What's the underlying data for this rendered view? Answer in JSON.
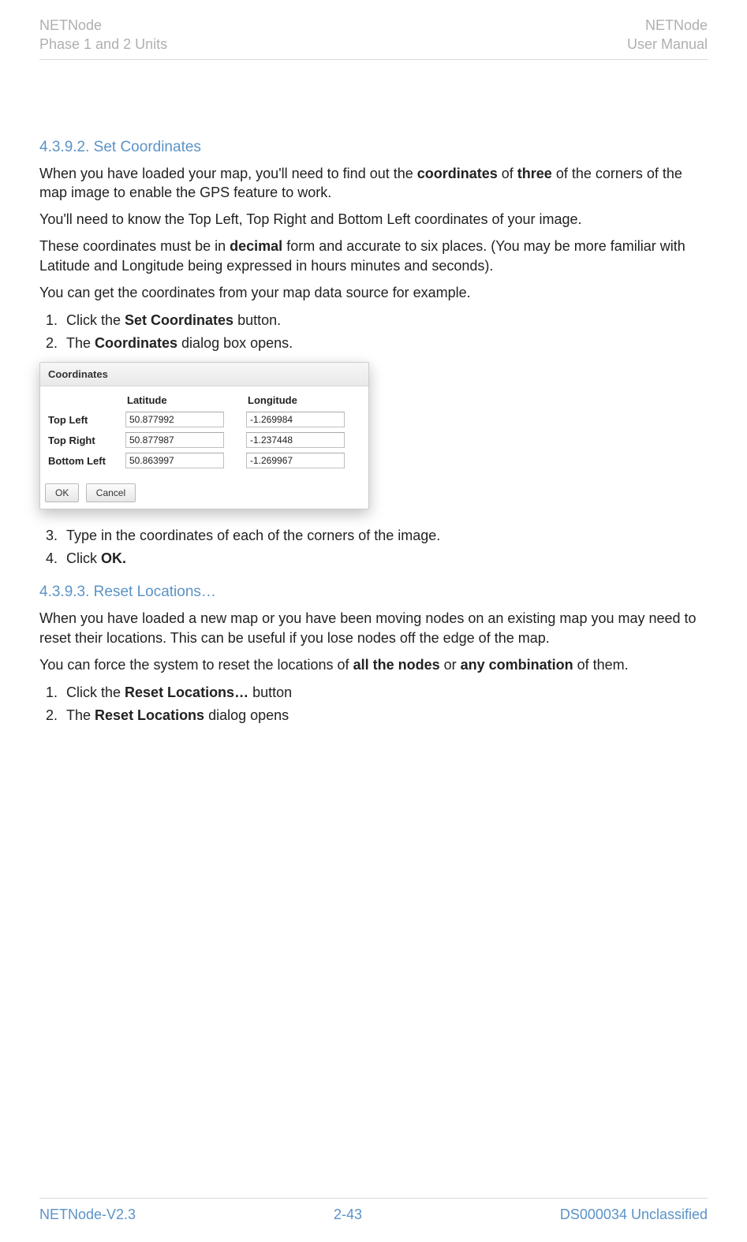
{
  "header": {
    "left_line1": "NETNode",
    "left_line2": "Phase 1 and 2 Units",
    "right_line1": "NETNode",
    "right_line2": "User Manual"
  },
  "section1": {
    "number_title": "4.3.9.2. Set Coordinates",
    "p1_pre": "When you have loaded your map, you'll need to find out the ",
    "p1_b1": "coordinates",
    "p1_mid": " of ",
    "p1_b2": "three",
    "p1_post": " of the corners of the map image to enable the GPS feature to work.",
    "p2": "You'll need to know the Top Left, Top Right and Bottom Left coordinates of your image.",
    "p3_pre": "These coordinates must be in ",
    "p3_b": "decimal",
    "p3_post": " form and accurate to six places. (You may be more familiar with Latitude and Longitude being expressed in hours minutes and seconds).",
    "p4": "You can get the coordinates from your map data source for example.",
    "li1_pre": "Click the ",
    "li1_b": "Set Coordinates",
    "li1_post": " button.",
    "li2_pre": "The ",
    "li2_b": "Coordinates",
    "li2_post": " dialog box opens.",
    "li3": "Type in the coordinates of each of the corners of the image.",
    "li4_pre": "Click ",
    "li4_b": "OK."
  },
  "dialog": {
    "title": "Coordinates",
    "lat_header": "Latitude",
    "lon_header": "Longitude",
    "rows": [
      {
        "label": "Top Left",
        "lat": "50.877992",
        "lon": "-1.269984"
      },
      {
        "label": "Top Right",
        "lat": "50.877987",
        "lon": "-1.237448"
      },
      {
        "label": "Bottom Left",
        "lat": "50.863997",
        "lon": "-1.269967"
      }
    ],
    "ok": "OK",
    "cancel": "Cancel"
  },
  "section2": {
    "number_title": "4.3.9.3. Reset Locations…",
    "p1": "When you have loaded a new map or you have been moving nodes on an existing map you may need to reset their locations. This can be useful if you lose nodes off the edge of the map.",
    "p2_pre": "You can force the system to reset the locations of ",
    "p2_b1": "all the nodes",
    "p2_mid": " or ",
    "p2_b2": "any combination",
    "p2_post": " of them.",
    "li1_pre": "Click the ",
    "li1_b": "Reset Locations…",
    "li1_post": " button",
    "li2_pre": "The ",
    "li2_b": "Reset Locations",
    "li2_post": " dialog opens"
  },
  "footer": {
    "left": "NETNode-V2.3",
    "center": "2-43",
    "right": "DS000034 Unclassified"
  }
}
